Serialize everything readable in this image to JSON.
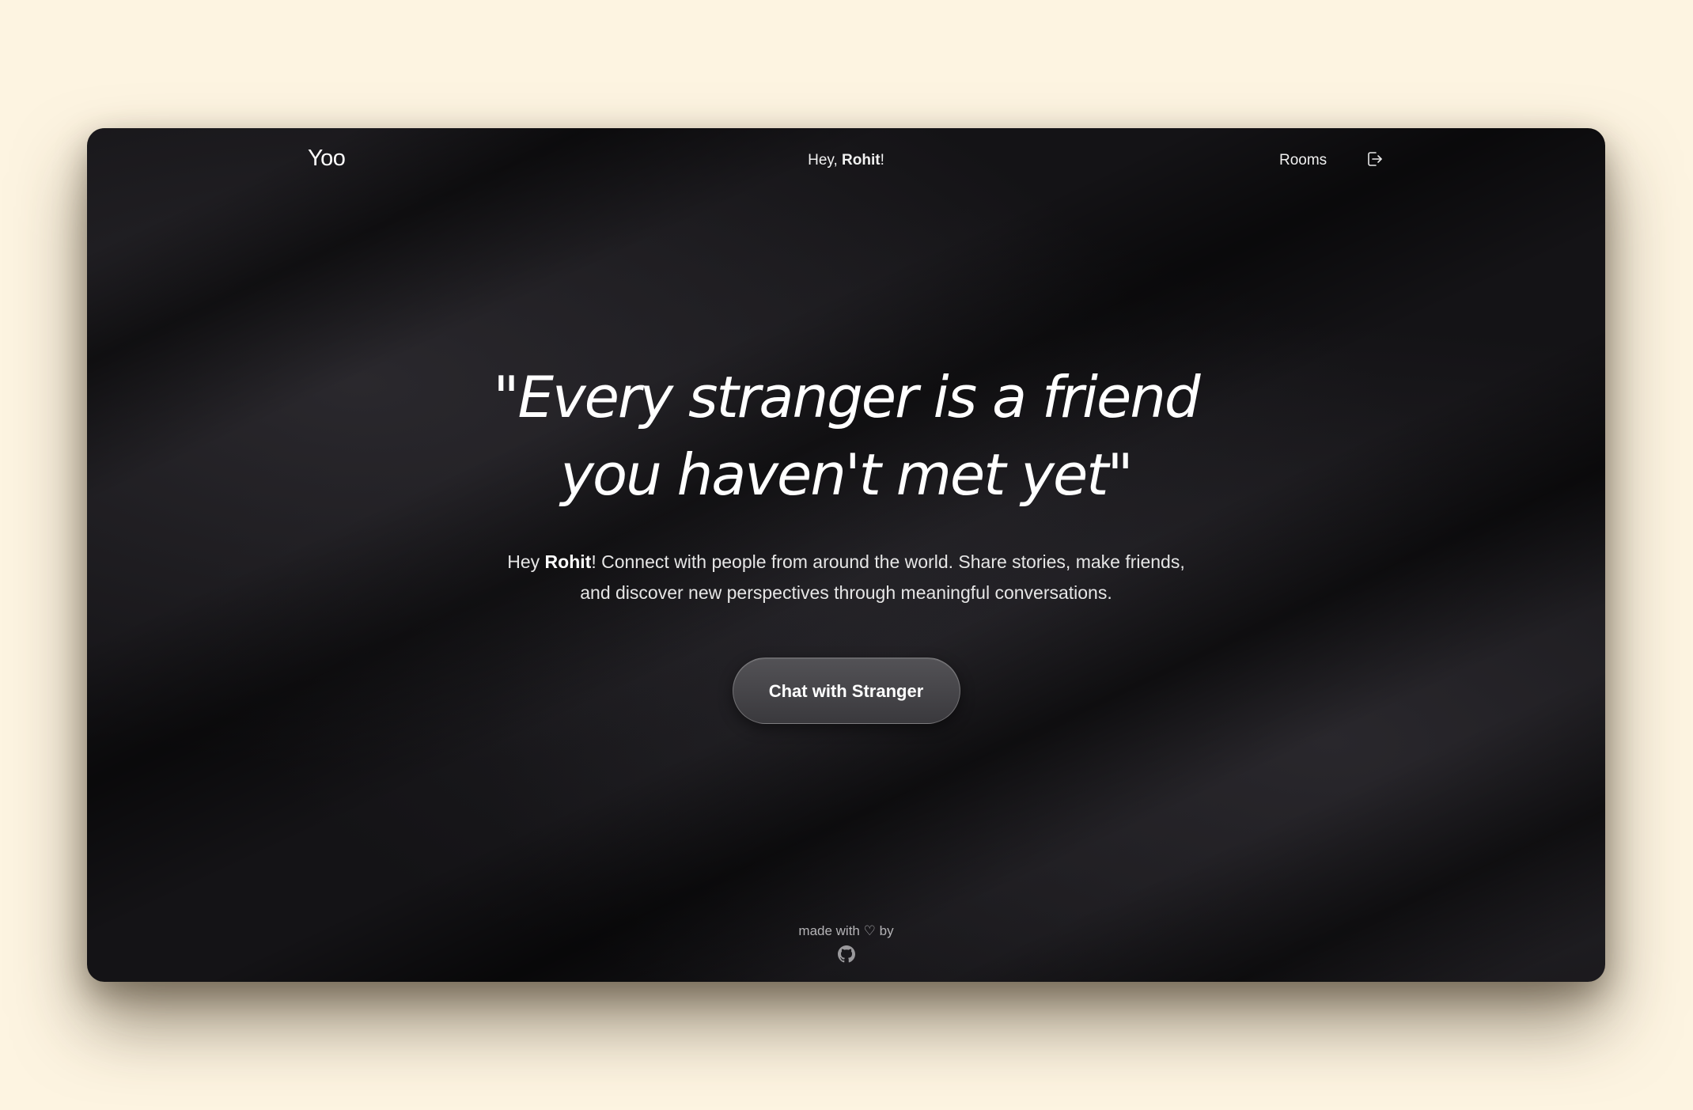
{
  "nav": {
    "logo": "Yoo",
    "greeting_prefix": "Hey, ",
    "user_name": "Rohit",
    "greeting_suffix": "!",
    "rooms_label": "Rooms",
    "logout_icon": "logout-icon"
  },
  "hero": {
    "quote": "\"Every stranger is a friend you haven't met yet\"",
    "subtitle_prefix": "Hey ",
    "subtitle_name": "Rohit",
    "subtitle_rest": "! Connect with people from around the world. Share stories, make friends, and discover new perspectives through meaningful conversations.",
    "cta_label": "Chat with Stranger"
  },
  "footer": {
    "made_with": "made with",
    "heart": "♡",
    "by": "by",
    "github_icon": "github-icon"
  },
  "colors": {
    "page_background": "#fdf4e1",
    "window_background": "#141316",
    "button_background": "#46454a",
    "text": "#ffffff"
  }
}
